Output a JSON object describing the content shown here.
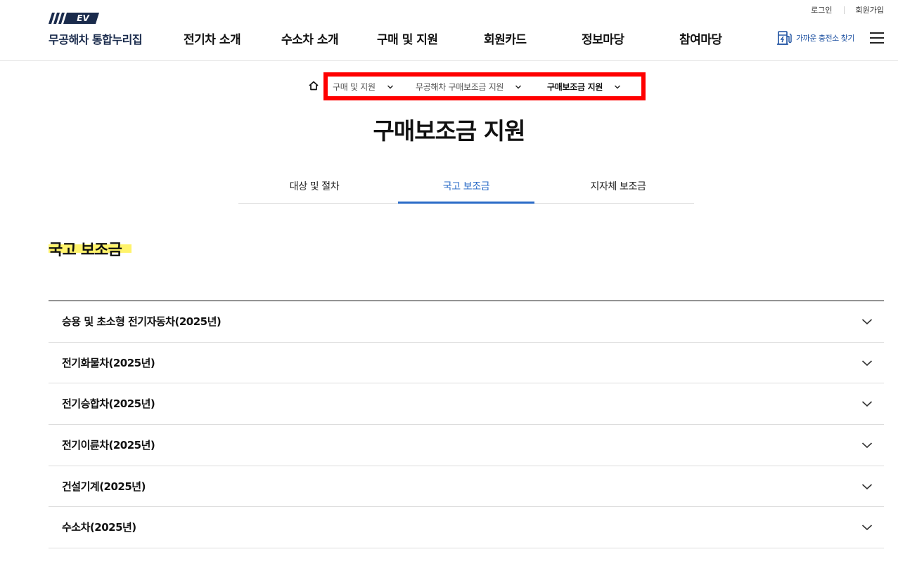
{
  "header": {
    "util_links": [
      "로그인",
      "회원가입"
    ],
    "logo_badge": "EV",
    "logo_name": "무공해차 통합누리집",
    "menu": [
      "전기차 소개",
      "수소차 소개",
      "구매 및 지원",
      "회원카드",
      "정보마당",
      "참여마당"
    ],
    "nearby_charger": "가까운 충전소 찾기"
  },
  "breadcrumb": {
    "home_icon": "home-icon",
    "items": [
      "구매 및 지원",
      "무공해차 구매보조금 지원",
      "구매보조금 지원"
    ]
  },
  "page": {
    "title": "구매보조금 지원",
    "tabs": [
      "대상 및 절차",
      "국고 보조금",
      "지자체 보조금"
    ],
    "active_tab_index": 1,
    "section_title": "국고 보조금"
  },
  "accordion": [
    "승용 및 초소형 전기자동차(2025년)",
    "전기화물차(2025년)",
    "전기승합차(2025년)",
    "전기이륜차(2025년)",
    "건설기계(2025년)",
    "수소차(2025년)"
  ],
  "colors": {
    "accent": "#2a6bc7",
    "highlight": "#fff36b",
    "breadcrumb_outline": "#ff0000",
    "logo_navy": "#1a2b4c"
  }
}
